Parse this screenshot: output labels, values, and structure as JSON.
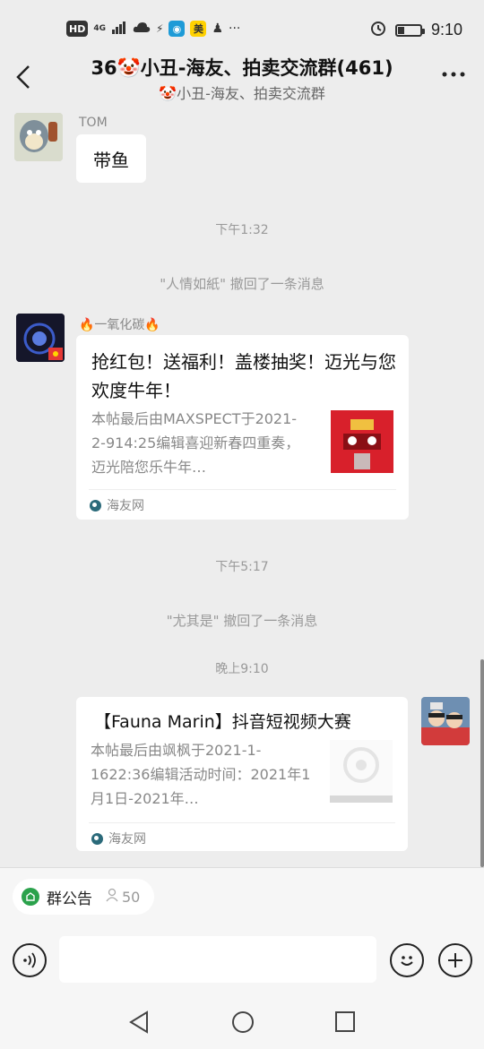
{
  "status_bar": {
    "network": "HD",
    "signal": "4G",
    "time": "9:10",
    "battery_level": 0.3
  },
  "header": {
    "back_icon": "chevron-left-icon",
    "title": "36🤡小丑-海友、拍卖交流群(461)",
    "subtitle": "🤡小丑-海友、拍卖交流群",
    "more_icon": "more-dots-icon"
  },
  "messages": {
    "msg1": {
      "sender": "TOM",
      "text": "带鱼"
    },
    "time1": "下午1:32",
    "recall1": "\"人情如紙\" 撤回了一条消息",
    "msg2": {
      "sender": "🔥一氧化碳🔥",
      "title": "抢红包！送福利！盖楼抽奖！迈光与您欢度牛年！",
      "desc": "本帖最后由MAXSPECT于2021-2-914:25编辑喜迎新春四重奏，迈光陪您乐牛年…",
      "source": "海友网"
    },
    "time2": "下午5:17",
    "recall2": "\"尤其是\" 撤回了一条消息",
    "time3": "晚上9:10",
    "msg3": {
      "title": "【Fauna Marin】抖音短视频大赛",
      "desc": "本帖最后由飒枫于2021-1-1622:36编辑活动时间：2021年1月1日-2021年…",
      "source": "海友网"
    }
  },
  "bottom": {
    "notice_label": "群公告",
    "member_count": "50",
    "voice_icon": "voice-icon",
    "emoji_icon": "emoji-icon",
    "plus_icon": "plus-icon"
  },
  "colors": {
    "background": "#ededed",
    "bubble": "#ffffff",
    "notice_green": "#2ba24c"
  }
}
